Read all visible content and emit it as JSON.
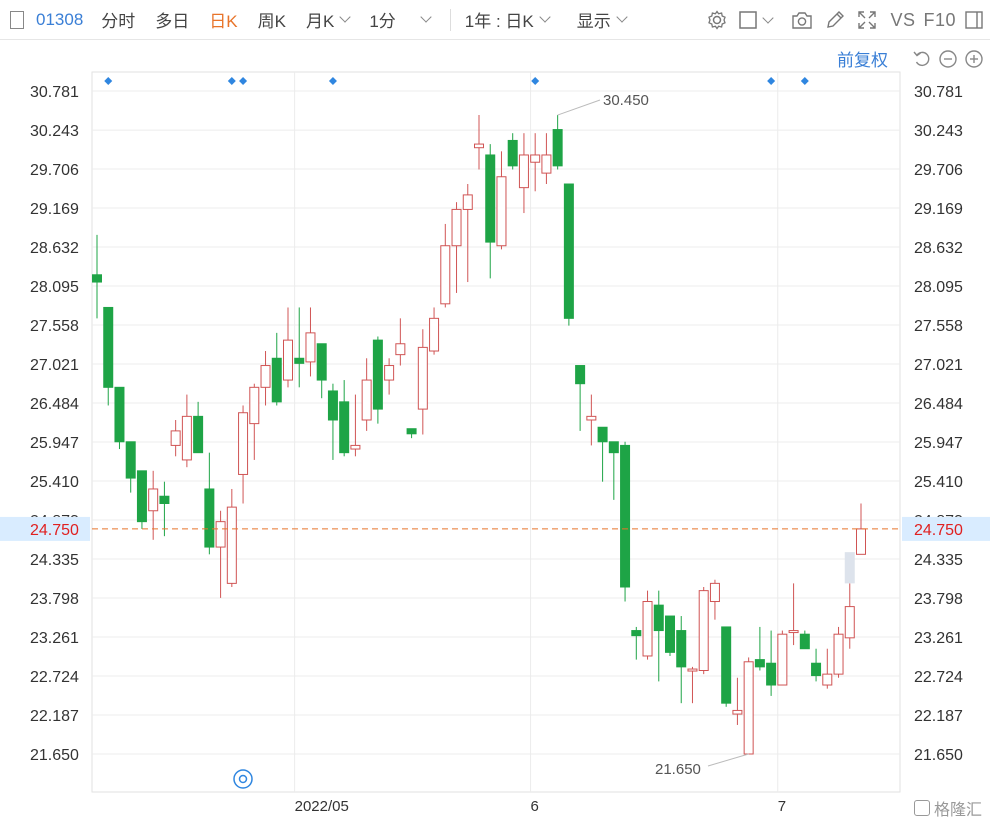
{
  "toolbar": {
    "code": "01308",
    "tabs": [
      "分时",
      "多日",
      "日K",
      "周K",
      "月K"
    ],
    "active_tab": "日K",
    "interval": "1分",
    "range": "1年 : 日K",
    "display": "显示",
    "vs": "VS",
    "f10": "F10"
  },
  "subbar": {
    "fq": "前复权"
  },
  "colors": {
    "up": "#d05454",
    "down": "#1ea446",
    "current": "#e8742a",
    "current_text": "#e02020",
    "grid": "#ececec",
    "axis_text": "#333333",
    "marker": "#2f86e0"
  },
  "watermark": "格隆汇",
  "chart_data": {
    "type": "candlestick",
    "ylim": [
      21.65,
      30.781
    ],
    "y_ticks": [
      "30.781",
      "30.243",
      "29.706",
      "29.169",
      "28.632",
      "28.095",
      "27.558",
      "27.021",
      "26.484",
      "25.947",
      "25.410",
      "24.873",
      "24.335",
      "23.798",
      "23.261",
      "22.724",
      "22.187",
      "21.650"
    ],
    "x_labels": [
      "2022/05",
      "6",
      "7"
    ],
    "current_price": "24.750",
    "annotations": {
      "high": "30.450",
      "low": "21.650"
    },
    "candles": [
      {
        "o": 28.25,
        "h": 28.8,
        "l": 27.65,
        "c": 28.15
      },
      {
        "o": 27.8,
        "h": 27.8,
        "l": 26.45,
        "c": 26.7
      },
      {
        "o": 26.7,
        "h": 26.7,
        "l": 25.85,
        "c": 25.95
      },
      {
        "o": 25.95,
        "h": 25.95,
        "l": 25.25,
        "c": 25.45
      },
      {
        "o": 25.55,
        "h": 25.55,
        "l": 24.75,
        "c": 24.85
      },
      {
        "o": 25.0,
        "h": 25.55,
        "l": 24.6,
        "c": 25.3
      },
      {
        "o": 25.2,
        "h": 25.4,
        "l": 24.65,
        "c": 25.1
      },
      {
        "o": 25.9,
        "h": 26.25,
        "l": 25.75,
        "c": 26.1
      },
      {
        "o": 25.7,
        "h": 26.6,
        "l": 25.6,
        "c": 26.3
      },
      {
        "o": 26.3,
        "h": 26.5,
        "l": 25.8,
        "c": 25.8
      },
      {
        "o": 25.3,
        "h": 25.8,
        "l": 24.4,
        "c": 24.5
      },
      {
        "o": 24.5,
        "h": 25.0,
        "l": 23.8,
        "c": 24.85
      },
      {
        "o": 24.0,
        "h": 25.3,
        "l": 23.95,
        "c": 25.05
      },
      {
        "o": 25.5,
        "h": 26.45,
        "l": 25.1,
        "c": 26.35
      },
      {
        "o": 26.2,
        "h": 26.75,
        "l": 25.7,
        "c": 26.7
      },
      {
        "o": 26.7,
        "h": 27.2,
        "l": 26.45,
        "c": 27.0
      },
      {
        "o": 27.1,
        "h": 27.45,
        "l": 26.45,
        "c": 26.5
      },
      {
        "o": 26.8,
        "h": 27.8,
        "l": 26.7,
        "c": 27.35
      },
      {
        "o": 27.1,
        "h": 27.8,
        "l": 26.7,
        "c": 27.03
      },
      {
        "o": 27.05,
        "h": 27.8,
        "l": 26.85,
        "c": 27.45
      },
      {
        "o": 27.3,
        "h": 27.3,
        "l": 26.55,
        "c": 26.8
      },
      {
        "o": 26.65,
        "h": 26.75,
        "l": 25.7,
        "c": 26.25
      },
      {
        "o": 26.5,
        "h": 26.8,
        "l": 25.75,
        "c": 25.8
      },
      {
        "o": 25.85,
        "h": 26.6,
        "l": 25.75,
        "c": 25.9
      },
      {
        "o": 26.25,
        "h": 27.1,
        "l": 26.1,
        "c": 26.8
      },
      {
        "o": 27.35,
        "h": 27.4,
        "l": 26.2,
        "c": 26.4
      },
      {
        "o": 26.8,
        "h": 27.1,
        "l": 26.6,
        "c": 27.0
      },
      {
        "o": 27.15,
        "h": 27.65,
        "l": 27.0,
        "c": 27.3
      },
      {
        "o": 26.13,
        "h": 26.13,
        "l": 26.0,
        "c": 26.06
      },
      {
        "o": 26.4,
        "h": 27.5,
        "l": 26.05,
        "c": 27.25
      },
      {
        "o": 27.2,
        "h": 27.8,
        "l": 27.15,
        "c": 27.65
      },
      {
        "o": 27.85,
        "h": 28.95,
        "l": 27.8,
        "c": 28.65
      },
      {
        "o": 28.65,
        "h": 29.25,
        "l": 28.0,
        "c": 29.15
      },
      {
        "o": 29.15,
        "h": 29.5,
        "l": 28.15,
        "c": 29.35
      },
      {
        "o": 30.0,
        "h": 30.45,
        "l": 29.7,
        "c": 30.05
      },
      {
        "o": 29.9,
        "h": 30.05,
        "l": 28.2,
        "c": 28.7
      },
      {
        "o": 28.65,
        "h": 29.95,
        "l": 28.6,
        "c": 29.6
      },
      {
        "o": 30.1,
        "h": 30.2,
        "l": 29.7,
        "c": 29.75
      },
      {
        "o": 29.45,
        "h": 30.2,
        "l": 29.1,
        "c": 29.9
      },
      {
        "o": 29.8,
        "h": 30.2,
        "l": 29.4,
        "c": 29.9
      },
      {
        "o": 29.65,
        "h": 30.2,
        "l": 29.5,
        "c": 29.9
      },
      {
        "o": 30.25,
        "h": 30.45,
        "l": 29.7,
        "c": 29.75
      },
      {
        "o": 29.5,
        "h": 29.5,
        "l": 27.55,
        "c": 27.65
      },
      {
        "o": 27.0,
        "h": 27.0,
        "l": 26.1,
        "c": 26.75
      },
      {
        "o": 26.25,
        "h": 26.6,
        "l": 25.9,
        "c": 26.3
      },
      {
        "o": 26.15,
        "h": 26.15,
        "l": 25.4,
        "c": 25.95
      },
      {
        "o": 25.95,
        "h": 25.95,
        "l": 25.15,
        "c": 25.8
      },
      {
        "o": 25.9,
        "h": 25.95,
        "l": 23.75,
        "c": 23.95
      },
      {
        "o": 23.35,
        "h": 23.4,
        "l": 22.95,
        "c": 23.28
      },
      {
        "o": 23.0,
        "h": 23.9,
        "l": 22.95,
        "c": 23.75
      },
      {
        "o": 23.7,
        "h": 23.9,
        "l": 22.65,
        "c": 23.35
      },
      {
        "o": 23.55,
        "h": 23.55,
        "l": 23.0,
        "c": 23.05
      },
      {
        "o": 23.35,
        "h": 23.55,
        "l": 22.35,
        "c": 22.85
      },
      {
        "o": 22.8,
        "h": 22.85,
        "l": 22.35,
        "c": 22.82
      },
      {
        "o": 22.8,
        "h": 23.95,
        "l": 22.75,
        "c": 23.9
      },
      {
        "o": 23.75,
        "h": 24.05,
        "l": 23.5,
        "c": 24.0
      },
      {
        "o": 23.4,
        "h": 23.4,
        "l": 22.3,
        "c": 22.35
      },
      {
        "o": 22.2,
        "h": 22.7,
        "l": 22.05,
        "c": 22.25
      },
      {
        "o": 21.65,
        "h": 22.98,
        "l": 21.65,
        "c": 22.92
      },
      {
        "o": 22.95,
        "h": 23.4,
        "l": 22.8,
        "c": 22.85
      },
      {
        "o": 22.9,
        "h": 23.35,
        "l": 22.45,
        "c": 22.6
      },
      {
        "o": 22.6,
        "h": 23.35,
        "l": 22.6,
        "c": 23.3
      },
      {
        "o": 23.35,
        "h": 24.0,
        "l": 23.15,
        "c": 23.35
      },
      {
        "o": 23.3,
        "h": 23.35,
        "l": 23.1,
        "c": 23.1
      },
      {
        "o": 22.9,
        "h": 23.1,
        "l": 22.65,
        "c": 22.73
      },
      {
        "o": 22.6,
        "h": 23.1,
        "l": 22.55,
        "c": 22.75
      },
      {
        "o": 22.75,
        "h": 23.4,
        "l": 22.7,
        "c": 23.3
      },
      {
        "o": 23.25,
        "h": 24.0,
        "l": 23.1,
        "c": 23.68
      },
      {
        "o": 24.4,
        "h": 25.1,
        "l": 24.4,
        "c": 24.75
      }
    ],
    "marker_count": 7
  }
}
